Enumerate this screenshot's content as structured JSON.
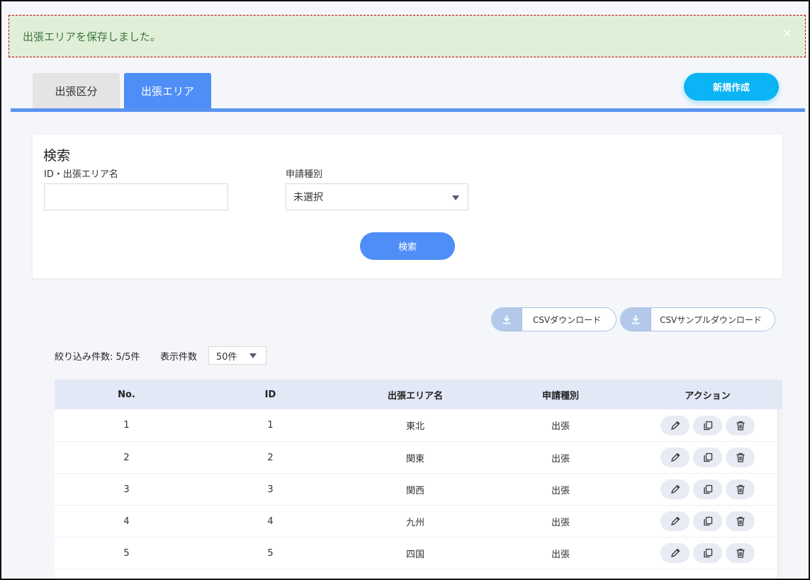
{
  "alert": {
    "message": "出張エリアを保存しました。",
    "close_icon": "close-icon"
  },
  "tabs": [
    {
      "label": "出張区分",
      "active": false
    },
    {
      "label": "出張エリア",
      "active": true
    }
  ],
  "new_button": {
    "label": "新規作成"
  },
  "search": {
    "title": "検索",
    "name_label": "ID・出張エリア名",
    "name_value": "",
    "type_label": "申請種別",
    "type_selected": "未選択",
    "button_label": "検索"
  },
  "csv": {
    "download_label": "CSVダウンロード",
    "sample_label": "CSVサンプルダウンロード",
    "icon": "download-icon"
  },
  "list": {
    "count_text": "絞り込み件数: 5/5件",
    "per_page_label": "表示件数",
    "per_page_value": "50件"
  },
  "table": {
    "headers": [
      "No.",
      "ID",
      "出張エリア名",
      "申請種別",
      "アクション"
    ],
    "rows": [
      {
        "no": "1",
        "id": "1",
        "name": "東北",
        "type": "出張"
      },
      {
        "no": "2",
        "id": "2",
        "name": "関東",
        "type": "出張"
      },
      {
        "no": "3",
        "id": "3",
        "name": "関西",
        "type": "出張"
      },
      {
        "no": "4",
        "id": "4",
        "name": "九州",
        "type": "出張"
      },
      {
        "no": "5",
        "id": "5",
        "name": "四国",
        "type": "出張"
      }
    ],
    "actions": [
      "pencil-icon",
      "copy-icon",
      "trash-icon"
    ]
  },
  "colors": {
    "alert_bg": "#e0efd8",
    "alert_text": "#3c763d",
    "primary": "#4f8ef7",
    "new_button": "#0ab4f5"
  }
}
